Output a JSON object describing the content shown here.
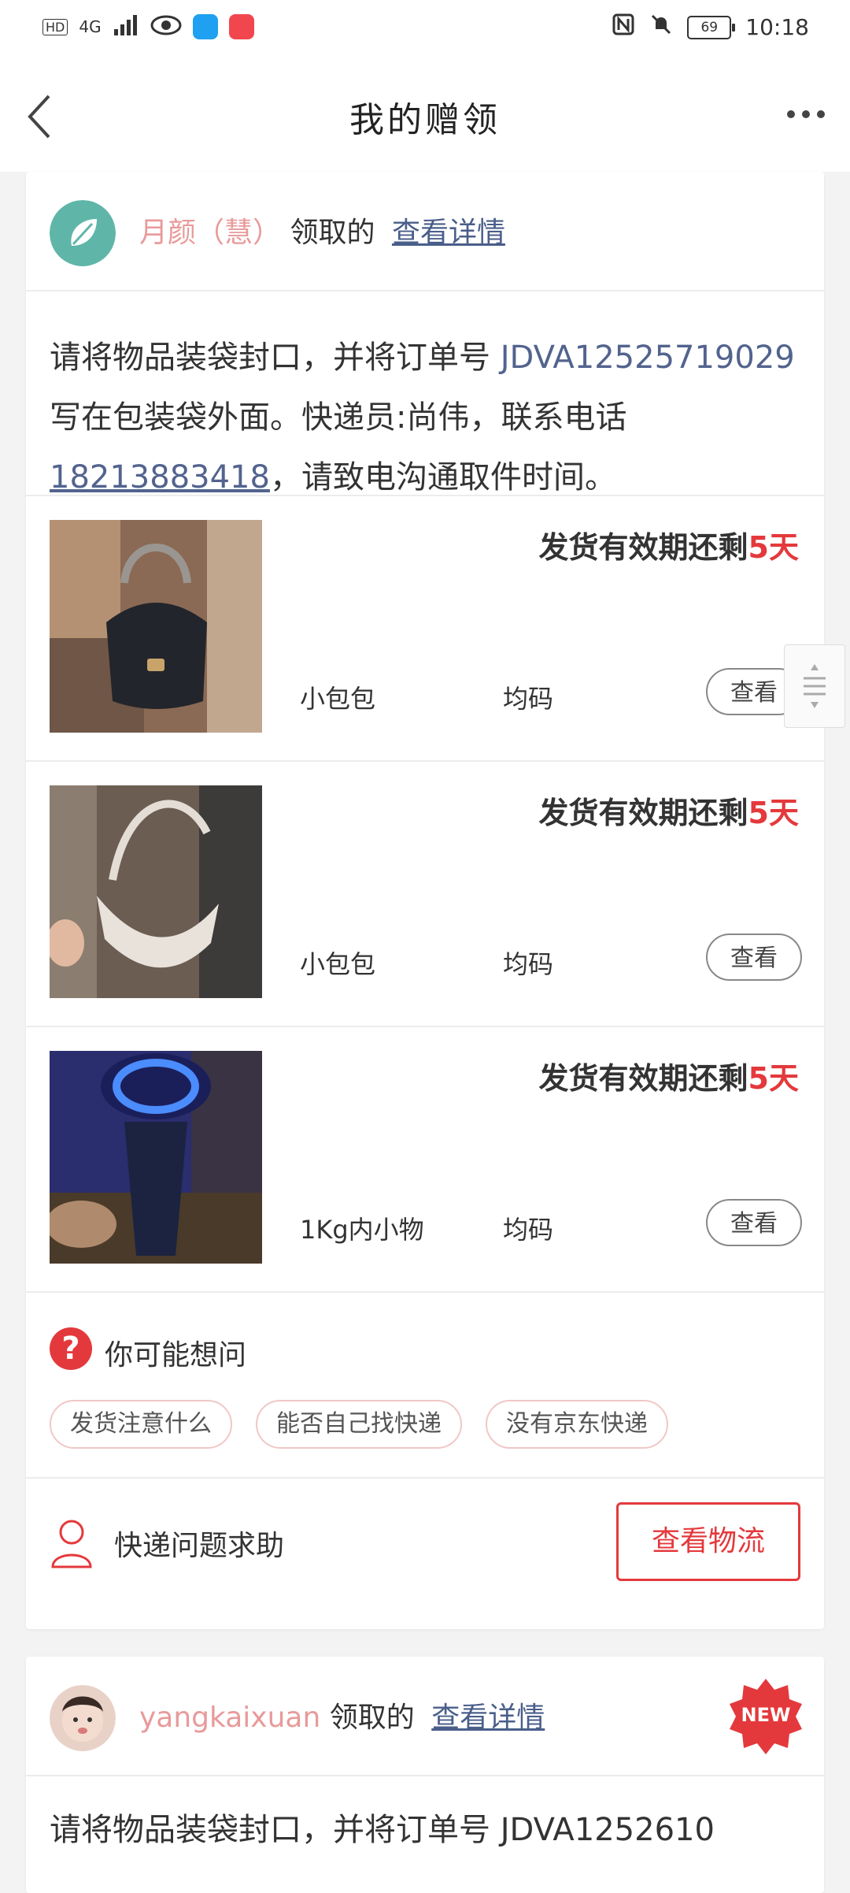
{
  "status_bar": {
    "left_label": "HD",
    "network": "4G",
    "time": "10:18",
    "battery": "69"
  },
  "header": {
    "title": "我的赠领"
  },
  "cards": [
    {
      "claimer": "月颜（慧）",
      "claimed_text": "领取的",
      "detail_link": "查看详情",
      "note_prefix": "请将物品装袋封口，并将订单号 ",
      "order_no": "JDVA12525719029",
      "note_middle": " 写在包装袋外面。快递员:尚伟，联系电话",
      "phone": "18213883418",
      "note_suffix": "，请致电沟通取件时间。",
      "items": [
        {
          "deadline_label": "发货有效期还剩",
          "days": "5天",
          "name": "小包包",
          "size": "均码",
          "view_label": "查看"
        },
        {
          "deadline_label": "发货有效期还剩",
          "days": "5天",
          "name": "小包包",
          "size": "均码",
          "view_label": "查看"
        },
        {
          "deadline_label": "发货有效期还剩",
          "days": "5天",
          "name": "1Kg内小物",
          "size": "均码",
          "view_label": "查看"
        }
      ],
      "faq": {
        "icon_text": "?",
        "title": "你可能想问",
        "chips": [
          "发货注意什么",
          "能否自己找快递",
          "没有京东快递"
        ]
      },
      "help": {
        "label": "快递问题求助",
        "logistics_button": "查看物流"
      }
    },
    {
      "claimer": "yangkaixuan",
      "claimed_text": "领取的",
      "detail_link": "查看详情",
      "badge": "NEW",
      "note_partial": "请将物品装袋封口，并将订单号 JDVA1252610"
    }
  ]
}
